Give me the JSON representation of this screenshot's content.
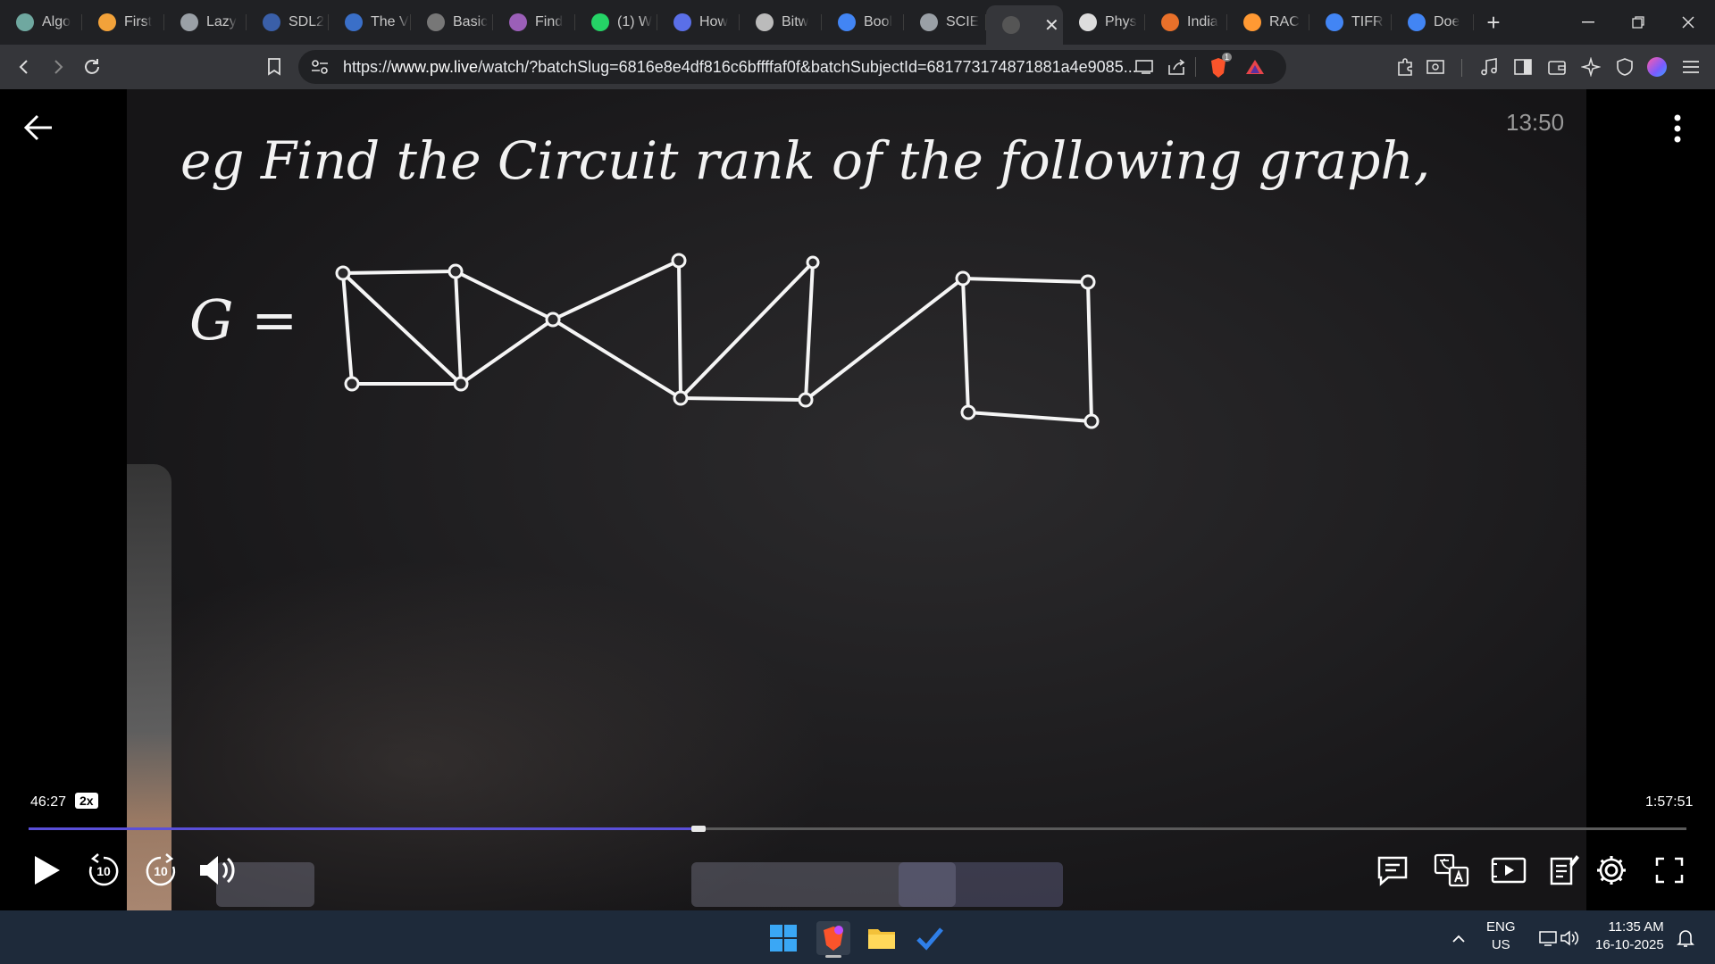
{
  "tabs": [
    {
      "label": "Algo",
      "icon": "gear-circle-icon",
      "color": "#6fa8a0"
    },
    {
      "label": "First",
      "icon": "stack-icon",
      "color": "#f2a23a"
    },
    {
      "label": "Lazy",
      "icon": "globe-icon",
      "color": "#9aa0a6"
    },
    {
      "label": "SDL2",
      "icon": "sdl-icon",
      "color": "#3a5fa8"
    },
    {
      "label": "The V",
      "icon": "wave-icon",
      "color": "#3a6fc8"
    },
    {
      "label": "Basic",
      "icon": "codebox-icon",
      "color": "#777"
    },
    {
      "label": "Find",
      "icon": "brain-icon",
      "color": "#9b5fb8"
    },
    {
      "label": "(1) W",
      "icon": "whatsapp-icon",
      "color": "#25d366"
    },
    {
      "label": "How",
      "icon": "bookmark-icon",
      "color": "#5a6fe8"
    },
    {
      "label": "Bitw",
      "icon": "orkg-icon",
      "color": "#bbb"
    },
    {
      "label": "Bool",
      "icon": "google-icon",
      "color": "#4285f4"
    },
    {
      "label": "SCIE",
      "icon": "globe-icon",
      "color": "#9aa0a6"
    },
    {
      "label": "",
      "icon": "pw-icon",
      "color": "#555",
      "active": true,
      "close": "✕"
    },
    {
      "label": "Phys",
      "icon": "wikipedia-icon",
      "color": "#ddd"
    },
    {
      "label": "India",
      "icon": "india-logo-icon",
      "color": "#e8702a"
    },
    {
      "label": "RAC",
      "icon": "india-flag-icon",
      "color": "#ff9933"
    },
    {
      "label": "TIFR",
      "icon": "google-icon",
      "color": "#4285f4"
    },
    {
      "label": "Doe",
      "icon": "google-icon",
      "color": "#4285f4"
    }
  ],
  "new_tab": "+",
  "address": {
    "url_prefix": "https://",
    "url_host": "www.pw.live",
    "url_rest": "/watch/?batchSlug=6816e8e4df816c6bffffaf0f&batchSubjectId=681773174871881a4e9085..."
  },
  "extensions": {
    "brave_badge": "1"
  },
  "video": {
    "board_title": "eg Find the Circuit rank of the following graph,",
    "graph_label": "G =",
    "overlay_clock": "13:50",
    "current_time": "46:27",
    "speed": "2x",
    "total_time": "1:57:51",
    "progress": 0.404,
    "skip_back": "10",
    "skip_forward": "10"
  },
  "taskbar": {
    "lang_line1": "ENG",
    "lang_line2": "US",
    "time": "11:35 AM",
    "date": "16-10-2025"
  }
}
